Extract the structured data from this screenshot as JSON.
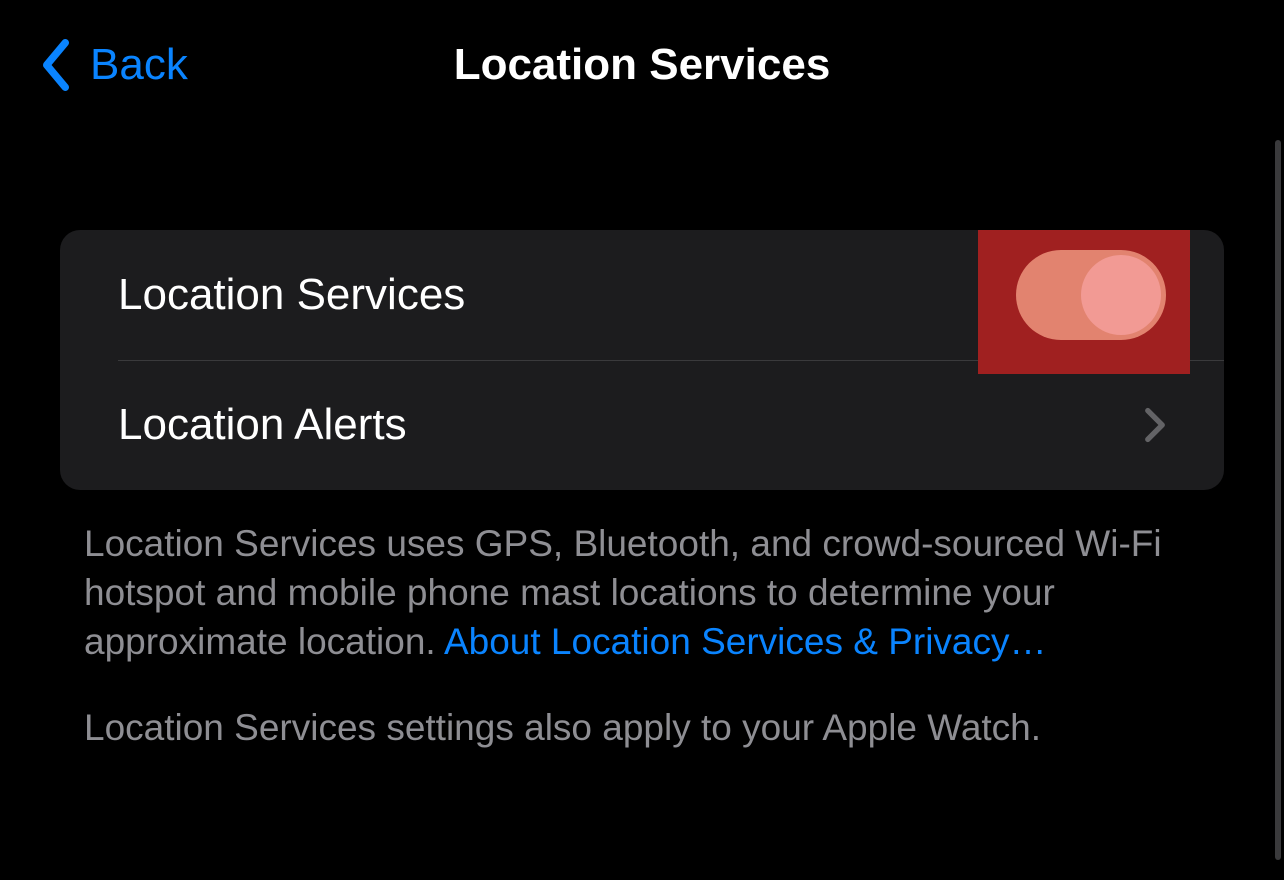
{
  "header": {
    "back_label": "Back",
    "title": "Location Services"
  },
  "rows": {
    "location_services": {
      "label": "Location Services",
      "toggle_on": true
    },
    "location_alerts": {
      "label": "Location Alerts"
    }
  },
  "footer": {
    "description_text": "Location Services uses GPS, Bluetooth, and crowd-sourced Wi-Fi hotspot and mobile phone mast locations to determine your approximate location. ",
    "link_text": "About Location Services & Privacy…",
    "watch_text": "Location Services settings also apply to your Apple Watch."
  },
  "colors": {
    "accent": "#0a84ff",
    "highlight": "#a02020"
  }
}
